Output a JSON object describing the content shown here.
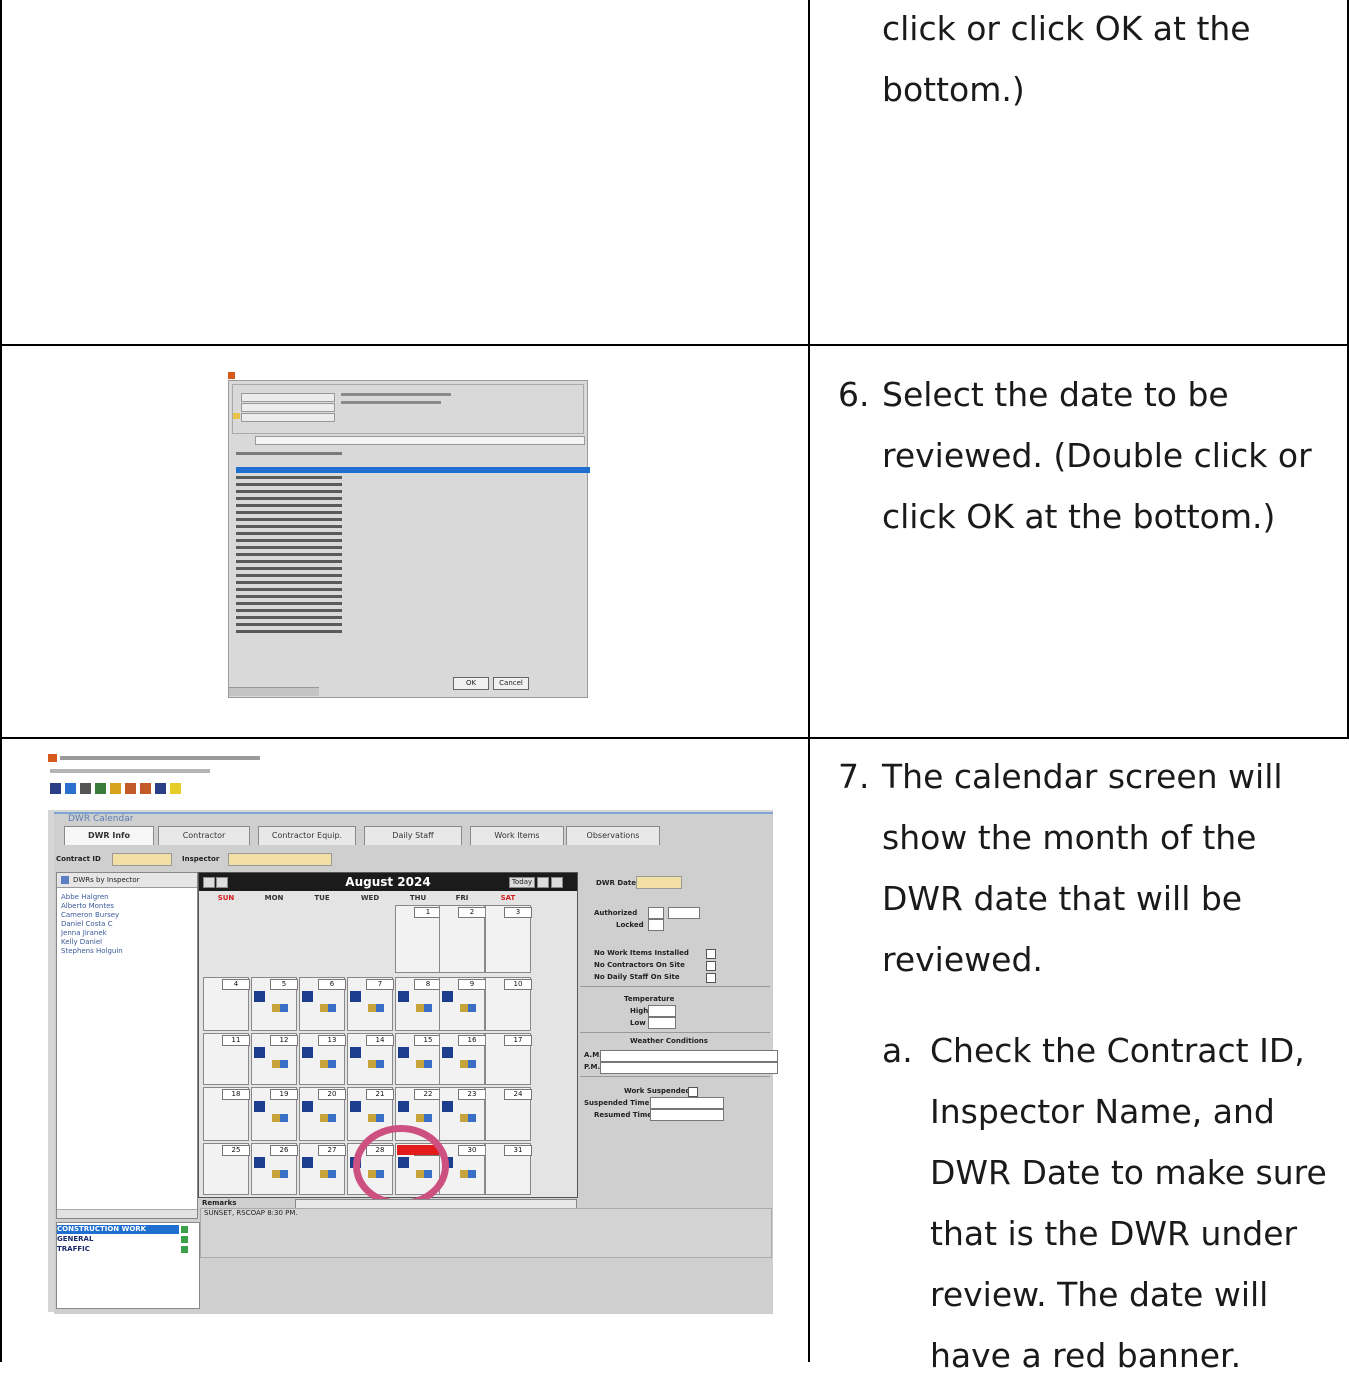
{
  "row1": {
    "text_lines": [
      "click or click OK at the",
      "bottom.)"
    ]
  },
  "row2": {
    "step_number": "6.",
    "text_lines": [
      "Select the date to be",
      "reviewed. (Double click or",
      "click OK at the bottom.)"
    ],
    "screenshot": {
      "ok_label": "OK",
      "cancel_label": "Cancel"
    }
  },
  "row3": {
    "step_number": "7.",
    "text_lines": [
      "The calendar screen will",
      "show the month of the",
      "DWR date that will be",
      "reviewed."
    ],
    "sub_number": "a.",
    "sub_lines": [
      "Check the Contract ID,",
      "Inspector Name, and",
      "DWR Date to make sure",
      "that is the DWR under",
      "review. The date will",
      "have a red banner."
    ],
    "screenshot": {
      "window_title": "DWR Calendar",
      "tabs": [
        "DWR Info",
        "Contractor",
        "Contractor Equip.",
        "Daily Staff",
        "Work Items",
        "Observations"
      ],
      "contract_label": "Contract ID",
      "inspector_label": "Inspector",
      "panel_title": "DWRs by Inspector",
      "inspectors": [
        "Abbe Halgren",
        "Alberto Montes",
        "Cameron Bursey",
        "Daniel Costa C",
        "Jenna Jiranek",
        "Kelly Daniel",
        "Stephens Holguin"
      ],
      "month_title": "August 2024",
      "today_label": "Today",
      "days_of_week": [
        "SUN",
        "MON",
        "TUE",
        "WED",
        "THU",
        "FRI",
        "SAT"
      ],
      "day_numbers": [
        "1",
        "2",
        "3",
        "4",
        "5",
        "6",
        "7",
        "8",
        "9",
        "10",
        "11",
        "12",
        "13",
        "14",
        "15",
        "16",
        "17",
        "18",
        "19",
        "20",
        "21",
        "22",
        "23",
        "24",
        "25",
        "26",
        "27",
        "28",
        "29",
        "30",
        "31"
      ],
      "dwr_date_label": "DWR Date",
      "authorized_label": "Authorized",
      "locked_label": "Locked",
      "no_work_items_label": "No Work Items Installed",
      "no_contractor_label": "No Contractors On Site",
      "no_daily_staff_label": "No Daily Staff On Site",
      "temperature_label": "Temperature",
      "high_label": "High",
      "low_label": "Low",
      "weather_label": "Weather Conditions",
      "am_label": "A.M.",
      "pm_label": "P.M.",
      "work_suspended_label": "Work Suspended",
      "suspended_time_label": "Suspended Time",
      "resumed_time_label": "Resumed Time",
      "remarks_label": "Remarks",
      "remarks_text": "SUNSET, RSCOAP 8:30 PM.",
      "work_types": [
        "CONSTRUCTION WORK",
        "GENERAL",
        "TRAFFIC"
      ]
    }
  }
}
